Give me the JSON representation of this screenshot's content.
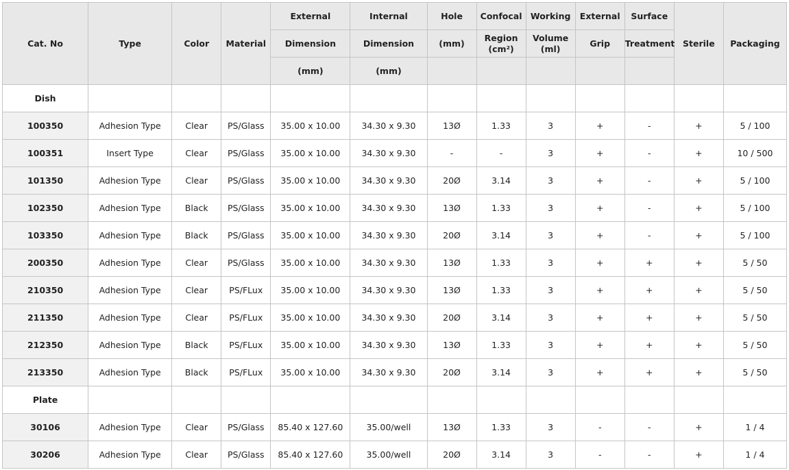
{
  "headers": {
    "cat_no": "Cat. No",
    "type": "Type",
    "color": "Color",
    "material": "Material",
    "external_dimension": [
      "External",
      "Dimension",
      "(mm)"
    ],
    "internal_dimension": [
      "Internal",
      "Dimension",
      "(mm)"
    ],
    "hole": [
      "Hole",
      "(mm)"
    ],
    "confocal_region": [
      "Confocal",
      "Region",
      "(cm²)"
    ],
    "working_volume": [
      "Working",
      "Volume",
      "(ml)"
    ],
    "external_grip": [
      "External",
      "Grip"
    ],
    "surface_treatment": [
      "Surface",
      "Treatment"
    ],
    "sterile": "Sterile",
    "packaging": "Packaging"
  },
  "sections": [
    {
      "label": "Dish",
      "rows": [
        [
          "100350",
          "Adhesion Type",
          "Clear",
          "PS/Glass",
          "35.00 x 10.00",
          "34.30 x 9.30",
          "13Ø",
          "1.33",
          "3",
          "+",
          "-",
          "+",
          "5 / 100"
        ],
        [
          "100351",
          "Insert Type",
          "Clear",
          "PS/Glass",
          "35.00 x 10.00",
          "34.30 x 9.30",
          "-",
          "-",
          "3",
          "+",
          "-",
          "+",
          "10 / 500"
        ],
        [
          "101350",
          "Adhesion Type",
          "Clear",
          "PS/Glass",
          "35.00 x 10.00",
          "34.30 x 9.30",
          "20Ø",
          "3.14",
          "3",
          "+",
          "-",
          "+",
          "5 / 100"
        ],
        [
          "102350",
          "Adhesion Type",
          "Black",
          "PS/Glass",
          "35.00 x 10.00",
          "34.30 x 9.30",
          "13Ø",
          "1.33",
          "3",
          "+",
          "-",
          "+",
          "5 / 100"
        ],
        [
          "103350",
          "Adhesion Type",
          "Black",
          "PS/Glass",
          "35.00 x 10.00",
          "34.30 x 9.30",
          "20Ø",
          "3.14",
          "3",
          "+",
          "-",
          "+",
          "5 / 100"
        ],
        [
          "200350",
          "Adhesion Type",
          "Clear",
          "PS/Glass",
          "35.00 x 10.00",
          "34.30 x 9.30",
          "13Ø",
          "1.33",
          "3",
          "+",
          "+",
          "+",
          "5 / 50"
        ],
        [
          "210350",
          "Adhesion Type",
          "Clear",
          "PS/FLux",
          "35.00 x 10.00",
          "34.30 x 9.30",
          "13Ø",
          "1.33",
          "3",
          "+",
          "+",
          "+",
          "5 / 50"
        ],
        [
          "211350",
          "Adhesion Type",
          "Clear",
          "PS/FLux",
          "35.00 x 10.00",
          "34.30 x 9.30",
          "20Ø",
          "3.14",
          "3",
          "+",
          "+",
          "+",
          "5 / 50"
        ],
        [
          "212350",
          "Adhesion Type",
          "Black",
          "PS/FLux",
          "35.00 x 10.00",
          "34.30 x 9.30",
          "13Ø",
          "1.33",
          "3",
          "+",
          "+",
          "+",
          "5 / 50"
        ],
        [
          "213350",
          "Adhesion Type",
          "Black",
          "PS/FLux",
          "35.00 x 10.00",
          "34.30 x 9.30",
          "20Ø",
          "3.14",
          "3",
          "+",
          "+",
          "+",
          "5 / 50"
        ]
      ]
    },
    {
      "label": "Plate",
      "rows": [
        [
          "30106",
          "Adhesion Type",
          "Clear",
          "PS/Glass",
          "85.40 x 127.60",
          "35.00/well",
          "13Ø",
          "1.33",
          "3",
          "-",
          "-",
          "+",
          "1 / 4"
        ],
        [
          "30206",
          "Adhesion Type",
          "Clear",
          "PS/Glass",
          "85.40 x 127.60",
          "35.00/well",
          "20Ø",
          "3.14",
          "3",
          "-",
          "-",
          "+",
          "1 / 4"
        ]
      ]
    }
  ],
  "colors": {
    "header_bg": "#e8e8e8",
    "cat_bg": "#f1f1f1",
    "border": "#c4c4c4"
  }
}
